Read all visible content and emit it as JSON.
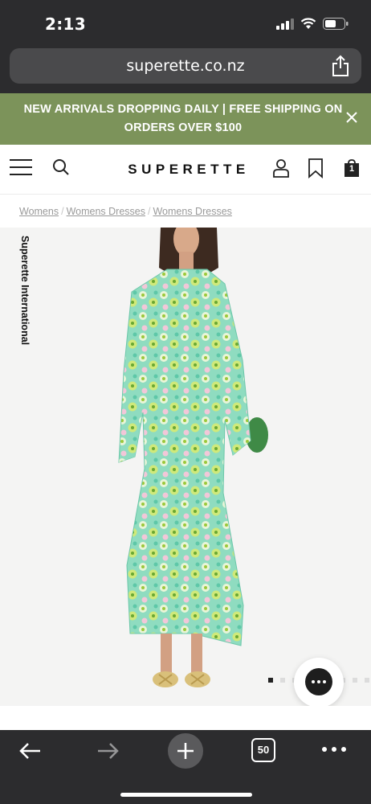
{
  "status_bar": {
    "time": "2:13"
  },
  "browser": {
    "url": "superette.co.nz",
    "tab_count": "50"
  },
  "promo": {
    "text": "NEW ARRIVALS DROPPING DAILY | FREE SHIPPING ON ORDERS OVER $100"
  },
  "header": {
    "logo": "SUPERETTE",
    "cart_count": "1"
  },
  "breadcrumb": {
    "items": [
      "Womens",
      "Womens Dresses",
      "Womens Dresses"
    ],
    "separator": "/"
  },
  "product": {
    "brand": "Superette International",
    "carousel": {
      "active_index": 0
    }
  },
  "colors": {
    "promo_bg": "#7c935a",
    "browser_chrome": "#2c2c2e",
    "dress_green": "#8fdcc0"
  },
  "icons": [
    "hamburger-menu-icon",
    "search-icon",
    "account-icon",
    "wishlist-bookmark-icon",
    "cart-bag-icon",
    "close-icon",
    "share-icon",
    "chat-icon",
    "back-arrow-icon",
    "forward-arrow-icon",
    "plus-icon",
    "more-icon"
  ]
}
